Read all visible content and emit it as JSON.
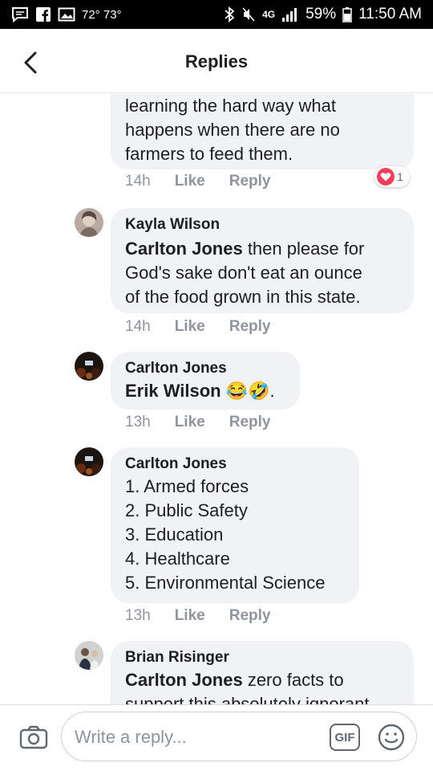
{
  "status_bar": {
    "temps": "72° 73°",
    "network": "4G",
    "battery": "59%",
    "time": "11:50 AM"
  },
  "header": {
    "title": "Replies"
  },
  "comments": [
    {
      "author": "",
      "lines": [
        "learning the hard way what",
        "happens when there are no",
        "farmers to feed them."
      ],
      "time": "14h",
      "like": "Like",
      "reply": "Reply",
      "reaction_count": "1"
    },
    {
      "author": "Kayla Wilson",
      "tag": "Carlton Jones",
      "first_rest": " then please for",
      "lines": [
        "God's sake don't eat an ounce",
        "of the food grown in this state."
      ],
      "time": "14h",
      "like": "Like",
      "reply": "Reply"
    },
    {
      "author": "Carlton Jones",
      "tag": "Erik Wilson",
      "emoji": "😂🤣",
      "trail": ".",
      "time": "13h",
      "like": "Like",
      "reply": "Reply"
    },
    {
      "author": "Carlton Jones",
      "lines": [
        "1. Armed forces",
        "2. Public Safety",
        "3. Education",
        "4. Healthcare",
        "5. Environmental Science"
      ],
      "time": "13h",
      "like": "Like",
      "reply": "Reply"
    },
    {
      "author": "Brian Risinger",
      "tag": "Carlton Jones",
      "first_rest": " zero facts to",
      "lines": [
        "support this absolutely ignorant"
      ]
    }
  ],
  "footer": {
    "placeholder": "Write a reply...",
    "gif_label": "GIF"
  },
  "icons": {
    "back": "back-arrow-icon",
    "camera": "camera-icon",
    "emoji": "emoji-icon"
  },
  "colors": {
    "bubble": "#f0f2f5",
    "meta_text": "#90949c",
    "heart": "#f33e58"
  }
}
